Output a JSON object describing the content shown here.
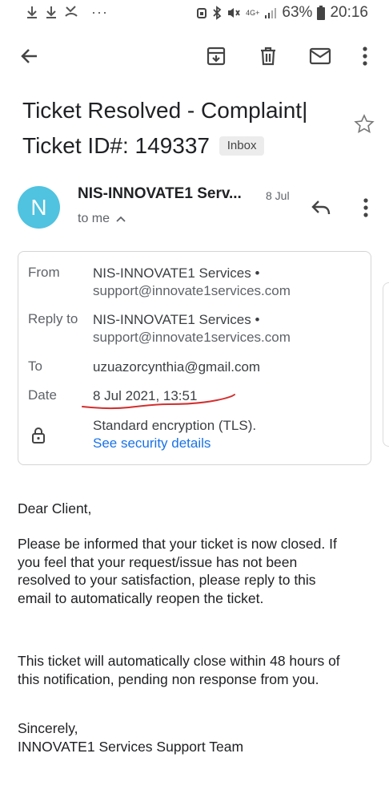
{
  "status_bar": {
    "battery": "63%",
    "time": "20:16",
    "network": "4G+",
    "more": "···"
  },
  "toolbar": {
    "back_icon": "arrow-back-icon",
    "archive_icon": "archive-icon",
    "delete_icon": "trash-icon",
    "mail_icon": "mail-icon",
    "more_icon": "more-vert-icon"
  },
  "subject": {
    "line1": "Ticket Resolved - Complaint|",
    "line2": "Ticket ID#: 149337",
    "label": "Inbox"
  },
  "sender": {
    "avatar_letter": "N",
    "avatar_color": "#4fc3e0",
    "name": "NIS-INNOVATE1 Serv...",
    "date": "8 Jul",
    "to": "to me"
  },
  "details": {
    "from_label": "From",
    "from_name": "NIS-INNOVATE1 Services •",
    "from_email": "support@innovate1services.com",
    "reply_label": "Reply to",
    "reply_name": "NIS-INNOVATE1 Services •",
    "reply_email": "support@innovate1services.com",
    "to_label": "To",
    "to_value": "uzuazorcynthia@gmail.com",
    "date_label": "Date",
    "date_value": "8 Jul 2021, 13:51",
    "encryption": "Standard encryption (TLS).",
    "security_link": "See security details"
  },
  "body": {
    "greeting": "Dear Client,",
    "p1_l1": "Please be informed that your ticket is now closed.  If",
    "p1_l2": "you feel that your request/issue has not been",
    "p1_l3": "resolved to your satisfaction, please reply to this",
    "p1_l4": "email to automatically reopen the ticket.",
    "p2_l1": "This ticket will automatically close within 48 hours of",
    "p2_l2": "this notification, pending non response from you.",
    "closing": "Sincerely,",
    "signature": "INNOVATE1 Services Support Team"
  },
  "colors": {
    "accent_link": "#1a73e8",
    "annotation_red": "#d32f2f"
  }
}
